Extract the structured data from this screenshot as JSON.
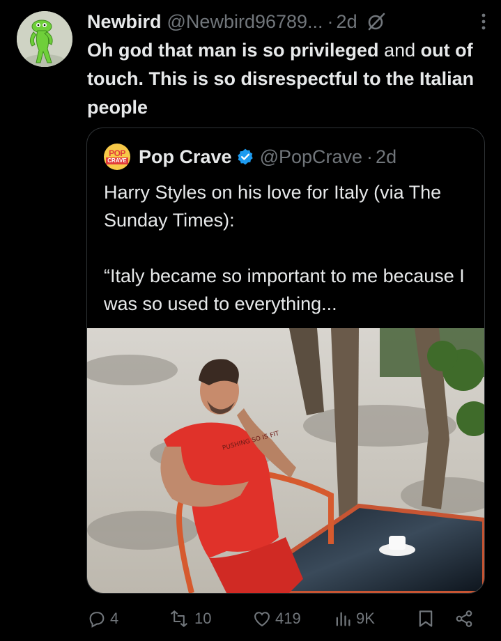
{
  "post": {
    "author_name": "Newbird",
    "author_handle": "@Newbird96789...",
    "separator": "·",
    "time": "2d",
    "text_parts": [
      {
        "text": "Oh god that man is so privileged ",
        "bold": true
      },
      {
        "text": "and ",
        "bold": false
      },
      {
        "text": "out of touch. This is so disrespectful to the Italian people",
        "bold": true
      }
    ]
  },
  "quote": {
    "author_name": "Pop Crave",
    "author_handle": "@PopCrave",
    "separator": "·",
    "time": "2d",
    "avatar_text_top": "POP",
    "avatar_text_bottom": "CRAVE",
    "line1": "Harry Styles on his love for Italy (via The Sunday Times):",
    "line2": "“Italy became so important to me because I was so used to everything...",
    "shirt_text": "PUSHING SO IS FIT"
  },
  "actions": {
    "replies": "4",
    "reposts": "10",
    "likes": "419",
    "views": "9K"
  },
  "colors": {
    "background": "#000000",
    "text": "#e7e9ea",
    "muted": "#71767b",
    "border": "#2f3336",
    "verified": "#1d9bf0"
  }
}
